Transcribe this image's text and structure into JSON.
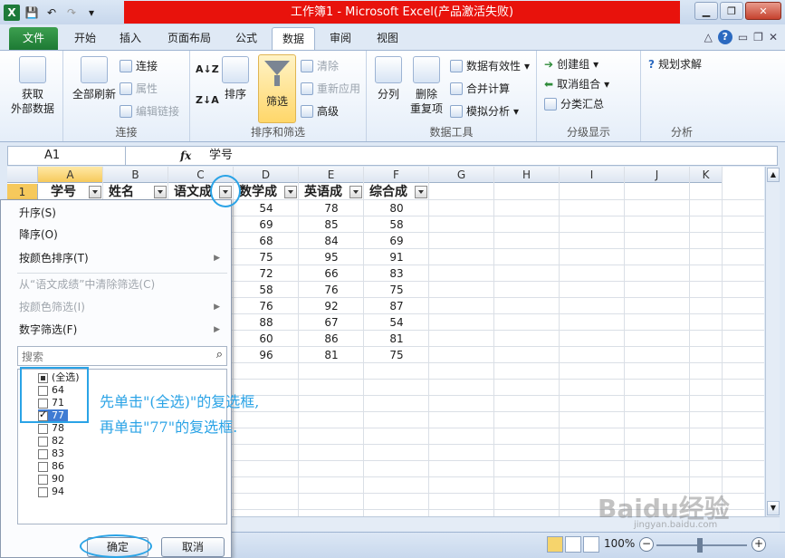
{
  "window": {
    "title": "工作簿1 - Microsoft Excel(产品激活失败)"
  },
  "tabs": {
    "file": "文件",
    "items": [
      "开始",
      "插入",
      "页面布局",
      "公式",
      "数据",
      "审阅",
      "视图"
    ],
    "active": "数据"
  },
  "ribbon": {
    "get_external": "获取\n外部数据",
    "refresh_all": "全部刷新",
    "connections": "连接",
    "properties": "属性",
    "edit_links": "编辑链接",
    "group_connections": "连接",
    "sort": "排序",
    "filter": "筛选",
    "clear": "清除",
    "reapply": "重新应用",
    "advanced": "高级",
    "group_sort_filter": "排序和筛选",
    "text_to_columns": "分列",
    "remove_dup_1": "删除",
    "remove_dup_2": "重复项",
    "data_validation": "数据有效性",
    "consolidate": "合并计算",
    "what_if": "模拟分析",
    "group_data_tools": "数据工具",
    "group": "创建组",
    "ungroup": "取消组合",
    "subtotal": "分类汇总",
    "group_outline": "分级显示",
    "solver": "规划求解",
    "group_analysis": "分析"
  },
  "formula_bar": {
    "name_box": "A1",
    "fx": "fx",
    "value": "学号"
  },
  "grid": {
    "columns": [
      "A",
      "B",
      "C",
      "D",
      "E",
      "F",
      "G",
      "H",
      "I",
      "J",
      "K"
    ],
    "headers": [
      "学号",
      "姓名",
      "语文成",
      "数学成",
      "英语成",
      "综合成"
    ],
    "row1": "1",
    "math": [
      "54",
      "69",
      "68",
      "75",
      "72",
      "58",
      "76",
      "88",
      "60",
      "96"
    ],
    "english": [
      "78",
      "85",
      "84",
      "95",
      "66",
      "76",
      "92",
      "67",
      "86",
      "81"
    ],
    "combined": [
      "80",
      "58",
      "69",
      "91",
      "83",
      "75",
      "87",
      "54",
      "81",
      "75"
    ]
  },
  "filter_menu": {
    "sort_asc": "升序(S)",
    "sort_desc": "降序(O)",
    "sort_color": "按颜色排序(T)",
    "clear_filter": "从“语文成绩”中清除筛选(C)",
    "filter_color": "按颜色筛选(I)",
    "number_filter": "数字筛选(F)",
    "search_placeholder": "搜索",
    "list": [
      "(全选)",
      "64",
      "71",
      "77",
      "78",
      "82",
      "83",
      "86",
      "90",
      "94"
    ],
    "ok": "确定",
    "cancel": "取消"
  },
  "annotation": {
    "line1": "先单击\"(全选)\"的复选框,",
    "line2": "再单击\"77\"的复选框."
  },
  "status": {
    "zoom": "100%"
  },
  "watermark": {
    "brand": "Baidu经验",
    "url": "jingyan.baidu.com"
  }
}
